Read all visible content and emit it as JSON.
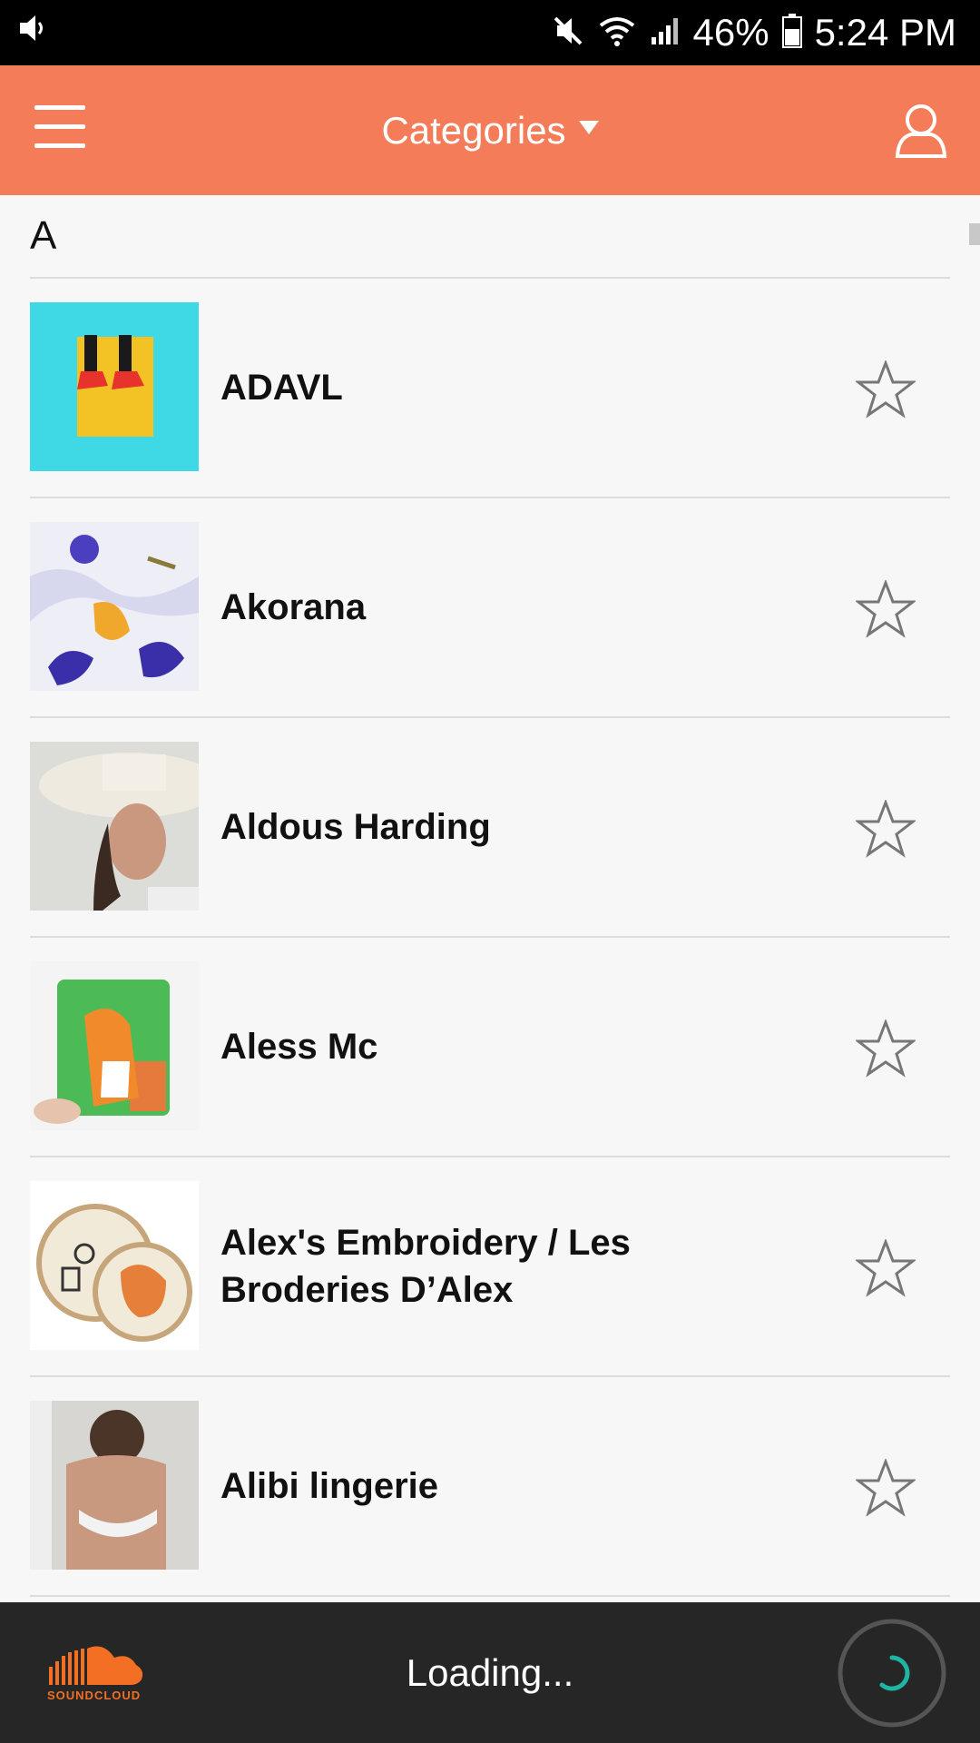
{
  "status_bar": {
    "battery": "46%",
    "time": "5:24 PM",
    "icons": [
      "volume-icon",
      "mute-icon",
      "wifi-icon",
      "signal-icon",
      "battery-icon"
    ]
  },
  "app_bar": {
    "title": "Categories",
    "menu_icon": "hamburger-menu-icon",
    "profile_icon": "user-profile-icon",
    "background": "#f47c58"
  },
  "section": {
    "letter": "A"
  },
  "items": [
    {
      "name": "ADAVL",
      "favorite": false
    },
    {
      "name": "Akorana",
      "favorite": false
    },
    {
      "name": "Aldous Harding",
      "favorite": false
    },
    {
      "name": "Aless Mc",
      "favorite": false
    },
    {
      "name": "Alex's Embroidery / Les Broderies D’Alex",
      "favorite": false
    },
    {
      "name": "Alibi lingerie",
      "favorite": false
    }
  ],
  "player": {
    "brand": "SOUNDCLOUD",
    "status": "Loading...",
    "accent": "#1fb5a3",
    "brand_color": "#f26f23"
  }
}
